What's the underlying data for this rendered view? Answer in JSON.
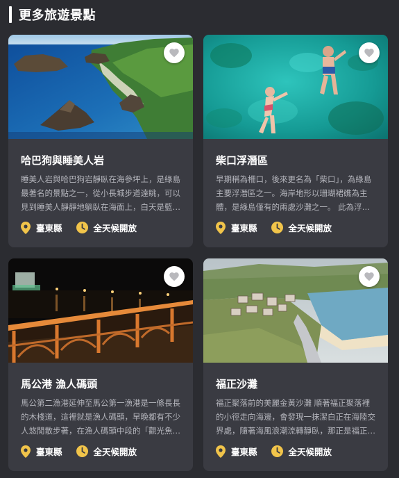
{
  "section": {
    "title": "更多旅遊景點"
  },
  "colors": {
    "background": "#2b2c31",
    "card": "#3a3b42",
    "accent": "#f1c44a",
    "text_muted": "#b4b5bc"
  },
  "icons": {
    "favorite": "heart-icon",
    "location": "location-pin-icon",
    "hours": "clock-icon"
  },
  "cards": [
    {
      "title": "哈巴狗與睡美人岩",
      "description": "睡美人岩與哈巴狗岩靜臥在海參坪上，是綠島最著名的景點之一，從小長城步道遠眺，可以見到睡美人靜靜地躺臥在海面上，白天是藍天碧海，傍晚夕陽西下更是美不勝收。",
      "location": "臺東縣",
      "hours": "全天候開放"
    },
    {
      "title": "柴口浮潛區",
      "description": "早期稱為柵口，後來更名為「柴口」，為綠島主要浮潛區之一。海岸地形以珊瑚裙礁為主體，是綠島僅有的兩處沙灘之一。 此為浮潛的熱門地點。",
      "location": "臺東縣",
      "hours": "全天候開放"
    },
    {
      "title": "馬公港 漁人碼頭",
      "description": "馬公第二漁港延伸至馬公第一漁港是一條長長的木棧道，這裡就是漁人碼頭，早晚都有不少人悠閒散步著，在漁人碼頭中段的「觀光魚市」可以品嚐新鮮漁獲。",
      "location": "臺東縣",
      "hours": "全天候開放"
    },
    {
      "title": "福正沙灘",
      "description": "福正聚落前的美麗金黃沙灘 順著福正聚落裡的小徑走向海邊，會發現一抹潔白正在海陸交界處，隨著海風浪潮流轉靜臥，那正是福正沙灘。",
      "location": "臺東縣",
      "hours": "全天候開放"
    }
  ]
}
